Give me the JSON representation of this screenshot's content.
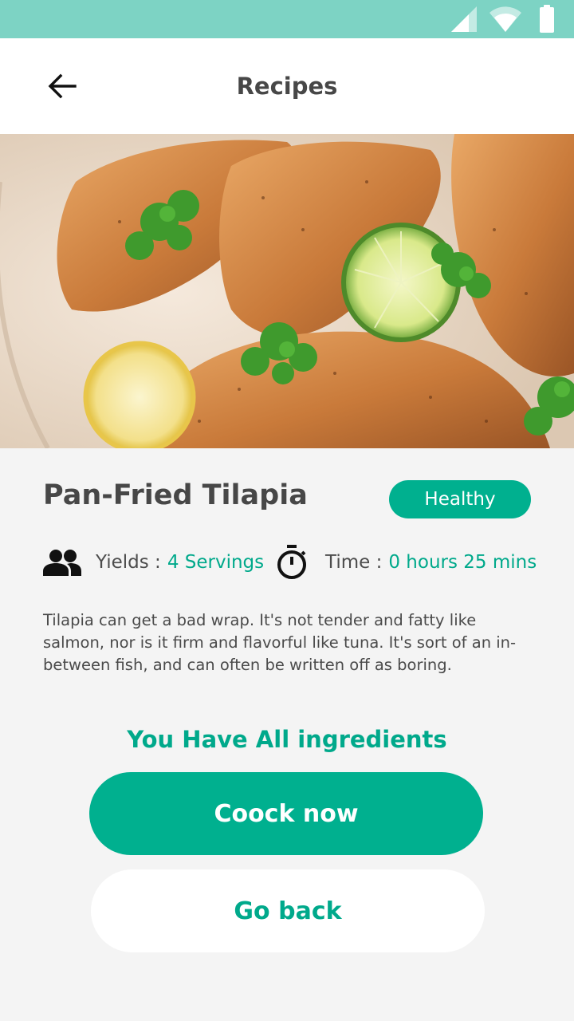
{
  "status_bar": {
    "icons": [
      "cellular-signal-icon",
      "wifi-icon",
      "battery-icon"
    ],
    "color": "#7dd3c4"
  },
  "app_bar": {
    "title": "Recipes",
    "back_icon": "arrow-left-icon"
  },
  "recipe": {
    "image": "pan-fried tilapia fillets with lime slices and cilantro",
    "title": "Pan-Fried Tilapia",
    "tag": "Healthy",
    "yields_label": "Yields :",
    "yields_value": "4 Servings",
    "time_label": "Time :",
    "time_value": "0 hours 25 mins",
    "description": "Tilapia can get a bad wrap. It's not tender and fatty like salmon, nor is it firm and flavorful like tuna. It's sort of an in-between fish, and can often be written off as boring."
  },
  "ingredients_status": "You Have All ingredients",
  "actions": {
    "primary_label": "Coock now",
    "secondary_label": "Go back"
  },
  "colors": {
    "accent": "#00b08f",
    "accent_text": "#00a98b",
    "text_dark": "#474747",
    "background": "#f4f4f4"
  }
}
